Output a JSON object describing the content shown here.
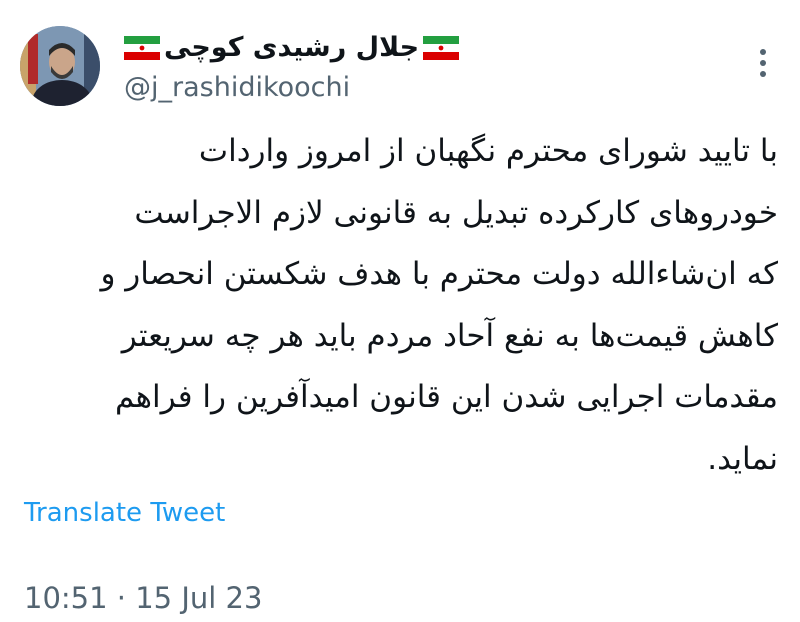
{
  "author": {
    "display_name": "جلال رشیدی کوچی",
    "handle": "@j_rashidikoochi",
    "flag_icon": "iran-flag-icon",
    "avatar_icon": "profile-photo"
  },
  "tweet": {
    "lines": [
      "با تایید شورای محترم نگهبان از امروز واردات",
      "خودروهای کارکرده تبدیل به قانونی لازم الاجراست",
      "که ان‌شاءالله دولت محترم با هدف شکستن انحصار و",
      "کاهش قیمت‌ها به نفع آحاد مردم باید هر چه سریعتر",
      "مقدمات اجرایی شدن این قانون امیدآفرین را فراهم",
      "نماید."
    ],
    "translate_label": "Translate Tweet",
    "timestamp": "10:51 · 15 Jul 23"
  },
  "more_icon": "more-vertical-icon",
  "colors": {
    "text": "#0f1419",
    "secondary": "#536471",
    "link": "#1d9bf0",
    "flag_green": "#239f40",
    "flag_red": "#da0000"
  }
}
